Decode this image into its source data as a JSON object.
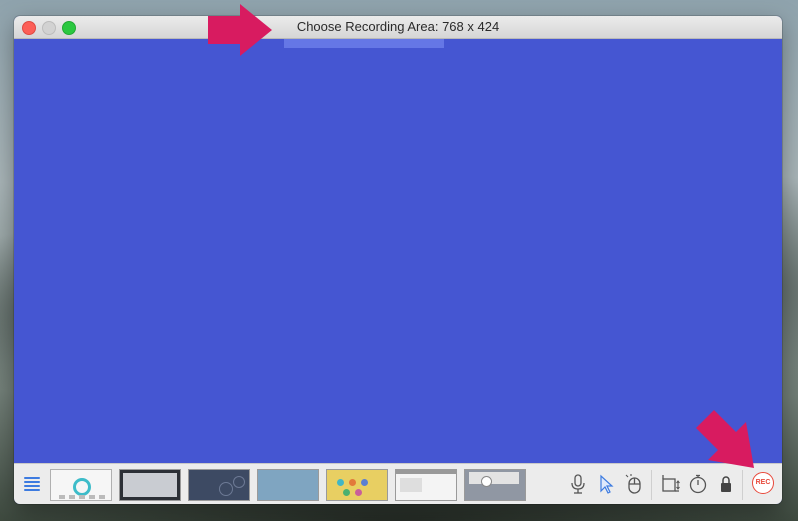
{
  "window": {
    "title": "Choose Recording Area: 768 x 424"
  },
  "toolbar": {
    "rec_label": "REC",
    "tools": [
      "microphone-icon",
      "cursor-icon",
      "mouse-click-icon",
      "crop-resize-icon",
      "timer-icon",
      "lock-icon"
    ]
  },
  "colors": {
    "recording_area": "#4556d2",
    "arrow": "#d81b60",
    "rec": "#e8483a",
    "accent": "#3d7be0"
  }
}
